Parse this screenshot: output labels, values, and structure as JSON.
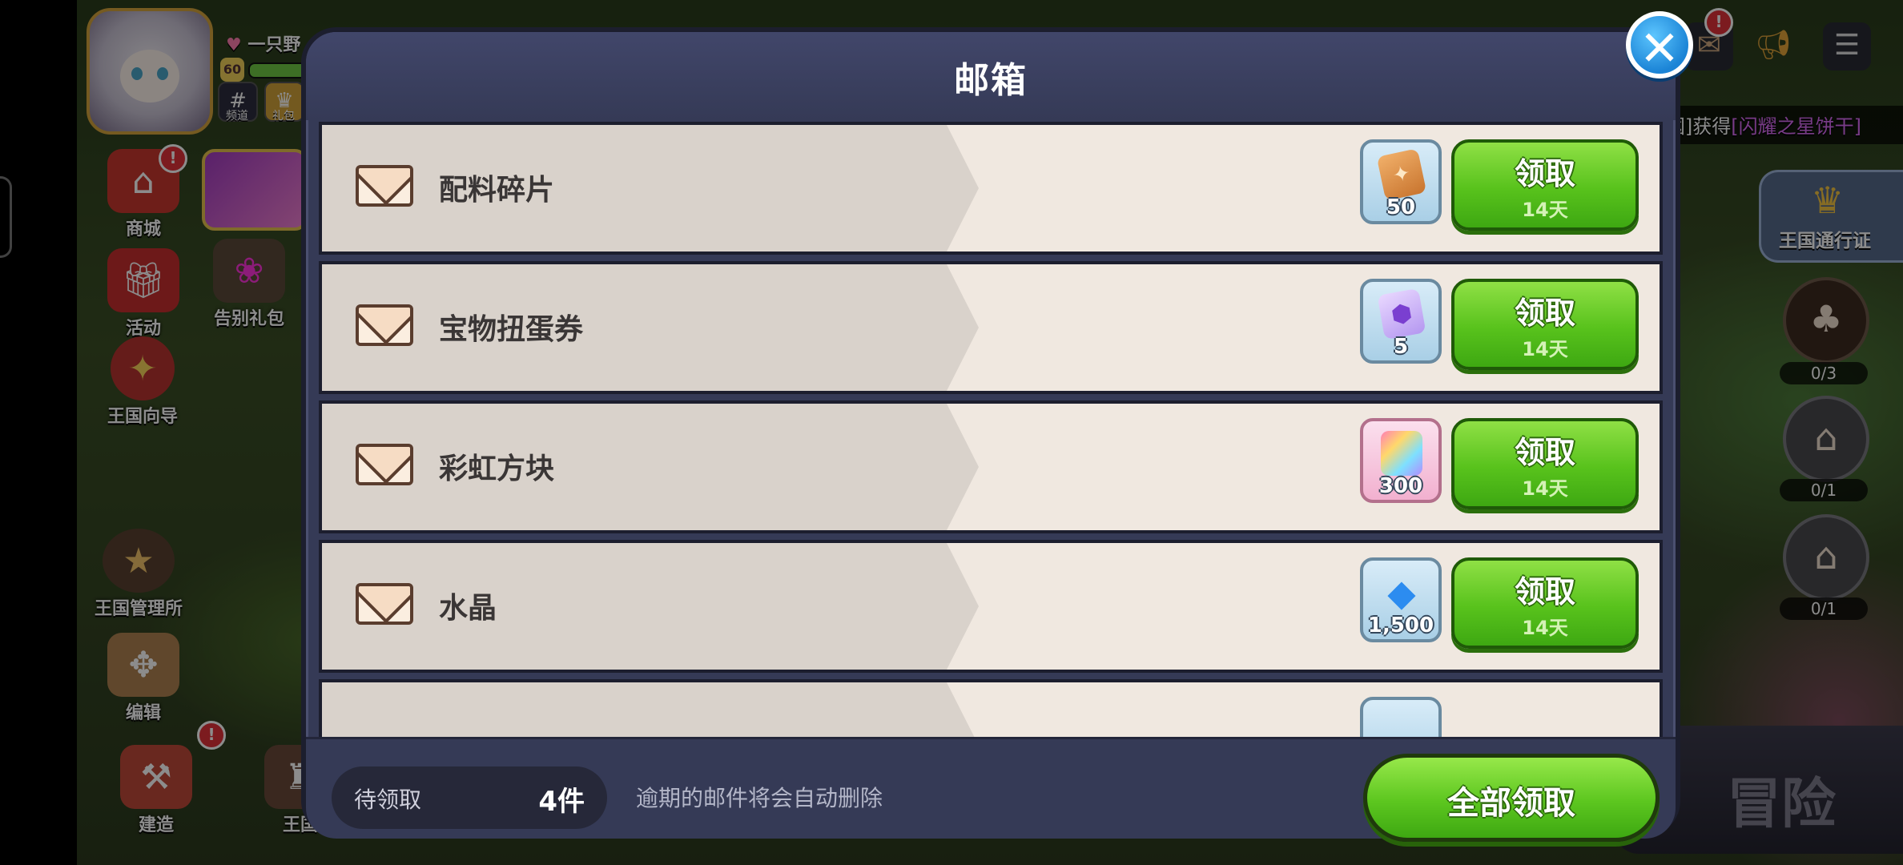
{
  "hud": {
    "player_name": "一只野",
    "level": "60",
    "exp_fraction": 0.7,
    "left_mini": [
      {
        "icon": "hash-icon",
        "label": "频道"
      },
      {
        "icon": "ranking-icon",
        "label": "礼包"
      }
    ],
    "left_buttons": [
      {
        "id": "shop",
        "label": "商城",
        "icon": "shop-icon",
        "badge": "!"
      },
      {
        "id": "event",
        "label": "活动",
        "icon": "gift-icon",
        "badge": ""
      },
      {
        "id": "farewell",
        "label": "告别礼包",
        "icon": "gift-bag-icon",
        "badge": ""
      },
      {
        "id": "guide",
        "label": "王国向导",
        "icon": "compass-icon",
        "badge": ""
      },
      {
        "id": "kingdom-admin",
        "label": "王国管理所",
        "icon": "cookie-icon",
        "badge": ""
      },
      {
        "id": "edit",
        "label": "编辑",
        "icon": "edit-icon",
        "badge": ""
      },
      {
        "id": "build",
        "label": "建造",
        "icon": "build-icon",
        "badge": "!"
      },
      {
        "id": "kingdom",
        "label": "王国",
        "icon": "castle-icon",
        "badge": ""
      }
    ],
    "right_top": [
      {
        "icon": "mail-icon",
        "badge": "!"
      },
      {
        "icon": "megaphone-icon",
        "badge": ""
      },
      {
        "icon": "menu-icon",
        "badge": ""
      }
    ],
    "notice": {
      "prefix": "[奇怪的王國]获得",
      "highlight": "[闪耀之星饼干]"
    },
    "pass_label": "王国通行证",
    "quests": [
      {
        "count": "0/3"
      },
      {
        "count": "0/1"
      },
      {
        "count": "0/1"
      }
    ],
    "adventure_label": "冒险"
  },
  "mailbox": {
    "title": "邮箱",
    "items": [
      {
        "title": "配料碎片",
        "reward_icon": "ingredient-shard-icon",
        "reward_count": "50",
        "claim_label": "领取",
        "expire": "14天"
      },
      {
        "title": "宝物扭蛋券",
        "reward_icon": "treasure-ticket-icon",
        "reward_count": "5",
        "claim_label": "领取",
        "expire": "14天"
      },
      {
        "title": "彩虹方块",
        "reward_icon": "rainbow-cube-icon",
        "reward_count": "300",
        "claim_label": "领取",
        "expire": "14天"
      },
      {
        "title": "水晶",
        "reward_icon": "crystal-icon",
        "reward_count": "1,500",
        "claim_label": "领取",
        "expire": "14天"
      }
    ],
    "footer": {
      "pending_label": "待领取",
      "pending_count": "4件",
      "expire_note": "逾期的邮件将会自动删除",
      "claim_all_label": "全部领取"
    }
  },
  "colors": {
    "modal_bg": "#353a56",
    "item_bg": "#f0e8e0",
    "claim_green": "#58c21c",
    "close_blue": "#1b84d6",
    "highlight_purple": "#d96cf5"
  }
}
